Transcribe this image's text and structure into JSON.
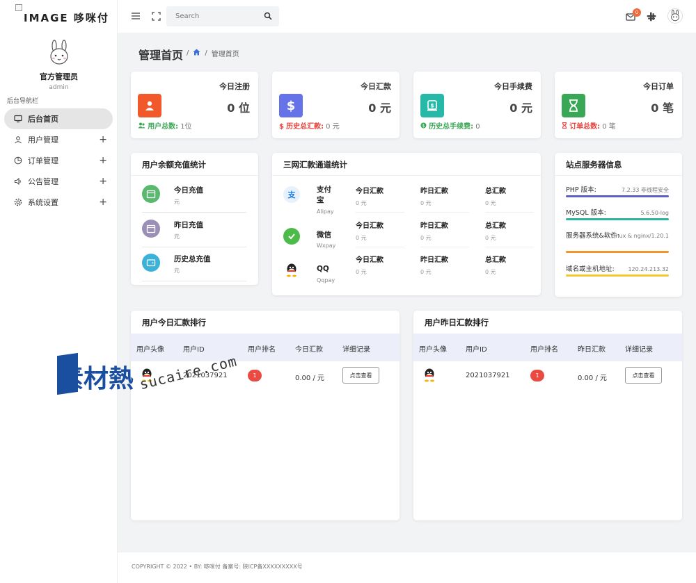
{
  "brand": {
    "logo_text": "IMAGE 哆咪付"
  },
  "profile": {
    "name": "官方管理员",
    "role": "admin"
  },
  "sidebar": {
    "label": "后台导航栏",
    "items": [
      {
        "label": "后台首页",
        "icon": "monitor-icon",
        "active": true
      },
      {
        "label": "用户管理",
        "icon": "user-icon",
        "expandable": "+"
      },
      {
        "label": "订单管理",
        "icon": "pie-chart-icon",
        "expandable": "+"
      },
      {
        "label": "公告管理",
        "icon": "speaker-icon",
        "expandable": "+"
      },
      {
        "label": "系统设置",
        "icon": "gear-icon",
        "expandable": "+"
      }
    ]
  },
  "topbar": {
    "search_placeholder": "Search",
    "mail_count": "0"
  },
  "page": {
    "title": "管理首页",
    "breadcrumb_sep": "/",
    "breadcrumb_current": "管理首页"
  },
  "stats": [
    {
      "title": "今日注册",
      "value": "0 位",
      "foot_label": "用户总数:",
      "foot_value": "1位",
      "color": "#f1592a",
      "foot_color": "#3aa757"
    },
    {
      "title": "今日汇款",
      "value": "0 元",
      "foot_label": "历史总汇款:",
      "foot_value": "0 元",
      "color": "#6672e8",
      "foot_color": "#e8433e"
    },
    {
      "title": "今日手续费",
      "value": "0 元",
      "foot_label": "历史总手续费:",
      "foot_value": "0",
      "color": "#28b8a8",
      "foot_color": "#3aa757"
    },
    {
      "title": "今日订单",
      "value": "0 笔",
      "foot_label": "订单总数:",
      "foot_value": "0 笔",
      "color": "#3aa757",
      "foot_color": "#e8433e"
    }
  ],
  "recharge": {
    "title": "用户余额充值统计",
    "rows": [
      {
        "label": "今日充值",
        "unit": "元"
      },
      {
        "label": "昨日充值",
        "unit": "元"
      },
      {
        "label": "历史总充值",
        "unit": "元"
      }
    ]
  },
  "channels": {
    "title": "三网汇款通道统计",
    "rows": [
      {
        "name": "支付宝",
        "code": "Alipay",
        "cols": [
          {
            "t": "今日汇款",
            "v": "0 元"
          },
          {
            "t": "昨日汇款",
            "v": "0 元"
          },
          {
            "t": "总汇款",
            "v": "0 元"
          }
        ]
      },
      {
        "name": "微信",
        "code": "Wxpay",
        "cols": [
          {
            "t": "今日汇款",
            "v": "0 元"
          },
          {
            "t": "昨日汇款",
            "v": "0 元"
          },
          {
            "t": "总汇款",
            "v": "0 元"
          }
        ]
      },
      {
        "name": "QQ",
        "code": "Qqpay",
        "cols": [
          {
            "t": "今日汇款",
            "v": "0 元"
          },
          {
            "t": "昨日汇款",
            "v": "0 元"
          },
          {
            "t": "总汇款",
            "v": "0 元"
          }
        ]
      }
    ]
  },
  "server": {
    "title": "站点服务器信息",
    "rows": [
      {
        "label": "PHP 版本:",
        "value": "7.2.33 非线程安全",
        "color": "#5b5fc7"
      },
      {
        "label": "MySQL 版本:",
        "value": "5.6.50-log",
        "color": "#2bb5a0"
      },
      {
        "label": "服务器系统&软件:",
        "value": "Linux & nginx/1.20.1",
        "color": "#f0962a"
      },
      {
        "label": "域名或主机地址:",
        "value": "120.24.213.32",
        "color": "#f5c82e"
      }
    ]
  },
  "today_rank": {
    "title": "用户今日汇款排行",
    "headers": [
      "用户头像",
      "用户ID",
      "用户排名",
      "今日汇款",
      "详细记录"
    ],
    "rows": [
      {
        "id": "2021037921",
        "rank": "1",
        "amount": "0.00 / 元",
        "action": "点击查看"
      }
    ]
  },
  "yesterday_rank": {
    "title": "用户昨日汇款排行",
    "headers": [
      "用户头像",
      "用户ID",
      "用户排名",
      "昨日汇款",
      "详细记录"
    ],
    "rows": [
      {
        "id": "2021037921",
        "rank": "1",
        "amount": "0.00 / 元",
        "action": "点击查看"
      }
    ]
  },
  "footer": {
    "text": "COPYRIGHT © 2022 • BY: 哆咪付 备案号: 陕ICP备XXXXXXXXX号"
  },
  "watermark": {
    "chinese": "素材熱",
    "latin": "sucaire.com"
  }
}
